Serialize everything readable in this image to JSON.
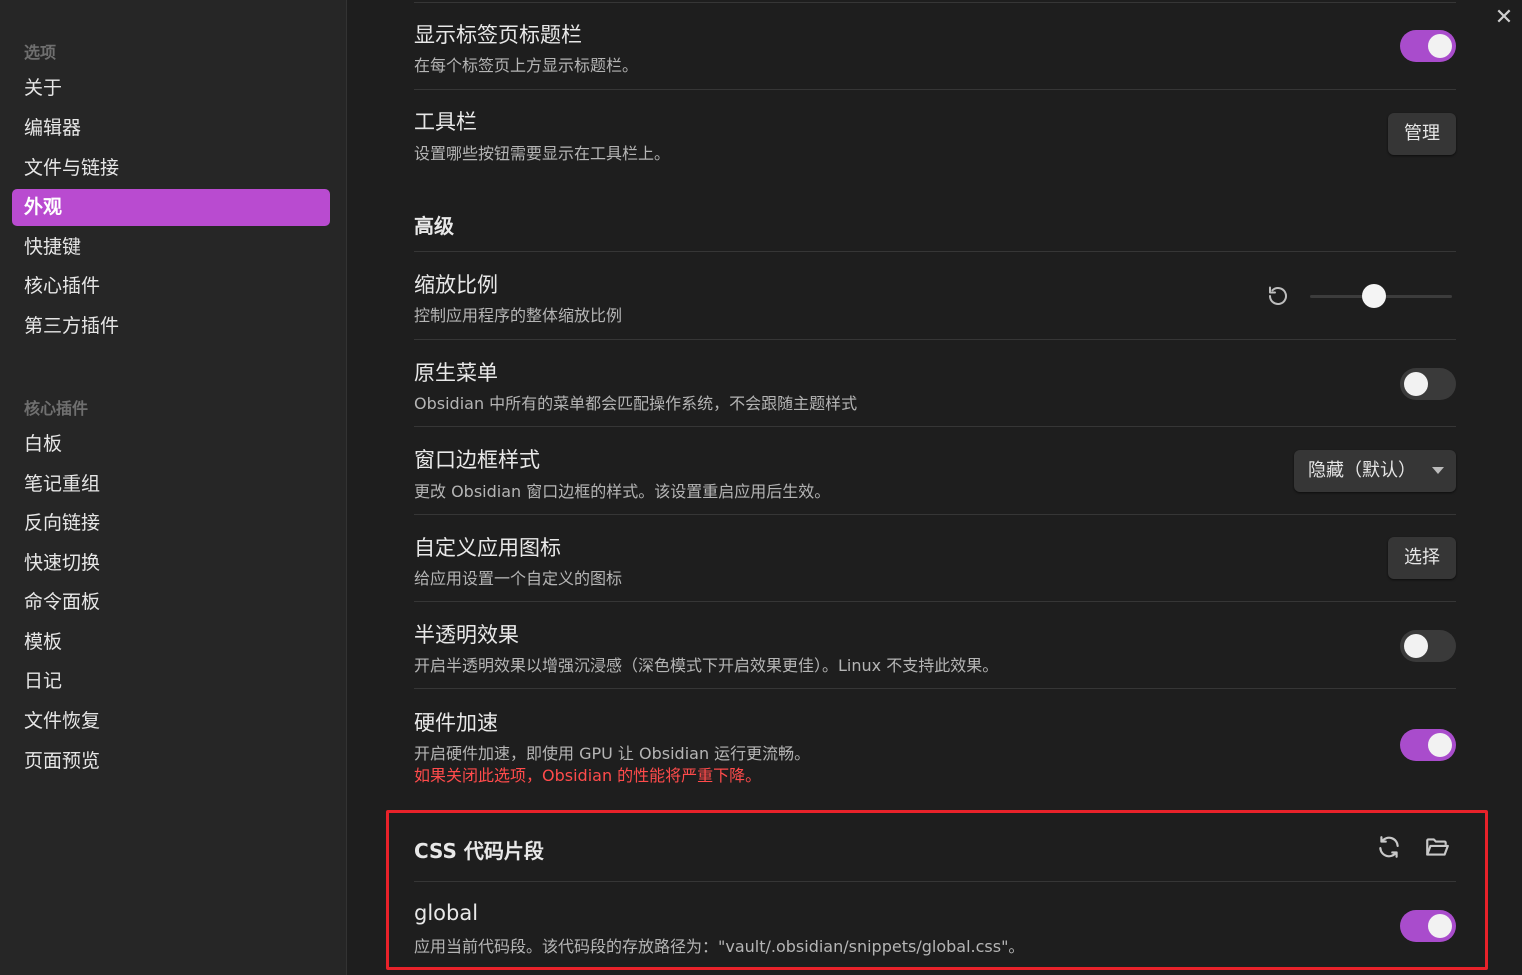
{
  "window": {
    "close_label": "✕"
  },
  "sidebar": {
    "options_heading": "选项",
    "options": [
      {
        "label": "关于",
        "active": false
      },
      {
        "label": "编辑器",
        "active": false
      },
      {
        "label": "文件与链接",
        "active": false
      },
      {
        "label": "外观",
        "active": true
      },
      {
        "label": "快捷键",
        "active": false
      },
      {
        "label": "核心插件",
        "active": false
      },
      {
        "label": "第三方插件",
        "active": false
      }
    ],
    "core_heading": "核心插件",
    "core_plugins": [
      {
        "label": "白板"
      },
      {
        "label": "笔记重组"
      },
      {
        "label": "反向链接"
      },
      {
        "label": "快速切换"
      },
      {
        "label": "命令面板"
      },
      {
        "label": "模板"
      },
      {
        "label": "日记"
      },
      {
        "label": "文件恢复"
      },
      {
        "label": "页面预览"
      }
    ]
  },
  "settings": {
    "tab_title_bar": {
      "title": "显示标签页标题栏",
      "desc": "在每个标签页上方显示标题栏。",
      "enabled": true
    },
    "toolbar": {
      "title": "工具栏",
      "desc": "设置哪些按钮需要显示在工具栏上。",
      "button": "管理"
    },
    "advanced_heading": "高级",
    "zoom": {
      "title": "缩放比例",
      "desc": "控制应用程序的整体缩放比例",
      "value_fraction": 0.45,
      "reset_icon": "reset-icon"
    },
    "native_menu": {
      "title": "原生菜单",
      "desc": "Obsidian 中所有的菜单都会匹配操作系统，不会跟随主题样式",
      "enabled": false
    },
    "window_frame": {
      "title": "窗口边框样式",
      "desc": "更改 Obsidian 窗口边框的样式。该设置重启应用后生效。",
      "selected": "隐藏（默认）"
    },
    "custom_icon": {
      "title": "自定义应用图标",
      "desc": "给应用设置一个自定义的图标",
      "button": "选择"
    },
    "translucency": {
      "title": "半透明效果",
      "desc": "开启半透明效果以增强沉浸感（深色模式下开启效果更佳）。Linux 不支持此效果。",
      "enabled": false
    },
    "hardware_accel": {
      "title": "硬件加速",
      "desc": "开启硬件加速，即使用 GPU 让 Obsidian 运行更流畅。",
      "warning": "如果关闭此选项，Obsidian 的性能将严重下降。",
      "enabled": true
    },
    "css_snippets": {
      "heading": "CSS 代码片段",
      "reload_icon": "reload-icon",
      "folder_icon": "folder-icon",
      "items": [
        {
          "title": "global",
          "desc": "应用当前代码段。该代码段的存放路径为：\"vault/.obsidian/snippets/global.css\"。",
          "enabled": true
        }
      ]
    }
  },
  "colors": {
    "accent": "#a94ccc",
    "sidebar_active": "#b94bd0",
    "warning": "#ff4b4b",
    "highlight_border": "#e8222a"
  }
}
